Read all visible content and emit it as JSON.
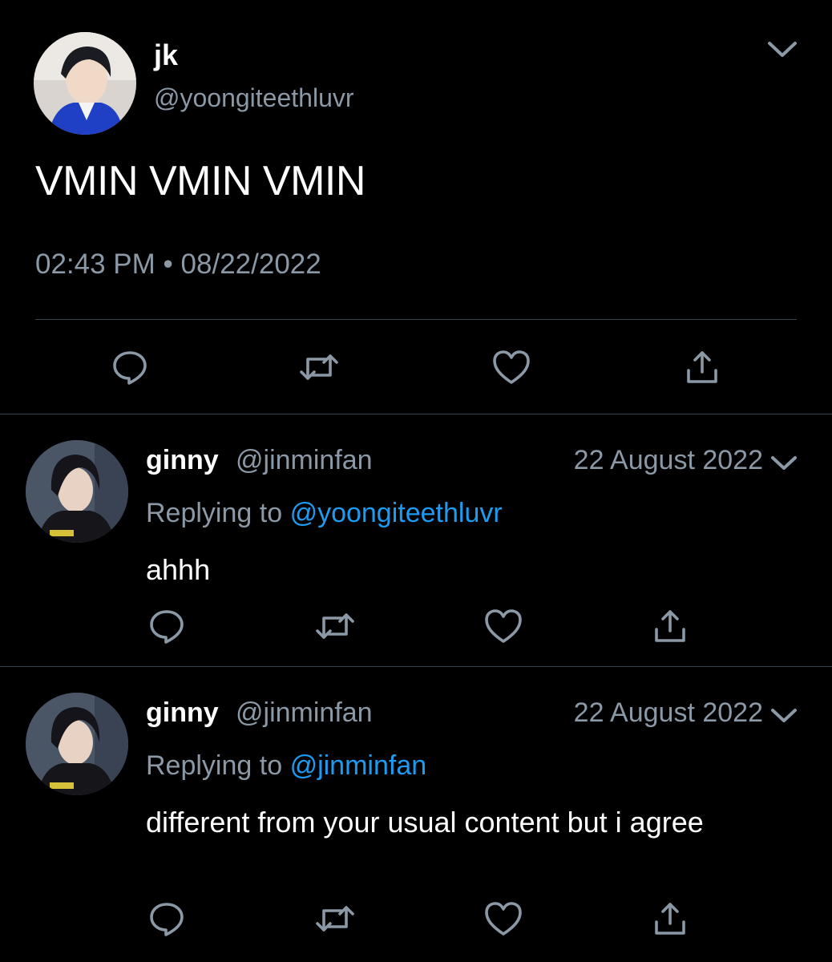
{
  "main_tweet": {
    "display_name": "jk",
    "handle": "@yoongiteethluvr",
    "text": "VMIN VMIN VMIN",
    "time": "02:43 PM",
    "separator": "•",
    "date": "08/22/2022",
    "actions": [
      "reply-icon",
      "retweet-icon",
      "like-icon",
      "share-icon"
    ]
  },
  "replies": [
    {
      "display_name": "ginny",
      "handle": "@jinminfan",
      "date": "22 August 2022",
      "replying_prefix": "Replying to",
      "replying_to": "@yoongiteethluvr",
      "text": "ahhh"
    },
    {
      "display_name": "ginny",
      "handle": "@jinminfan",
      "date": "22 August 2022",
      "replying_prefix": "Replying to",
      "replying_to": "@jinminfan",
      "text": "different from your usual content but i agree"
    }
  ],
  "colors": {
    "background": "#000000",
    "primary_text": "#ffffff",
    "secondary_text": "#8b98a5",
    "mention": "#1d9bf0",
    "divider": "#38444d"
  }
}
